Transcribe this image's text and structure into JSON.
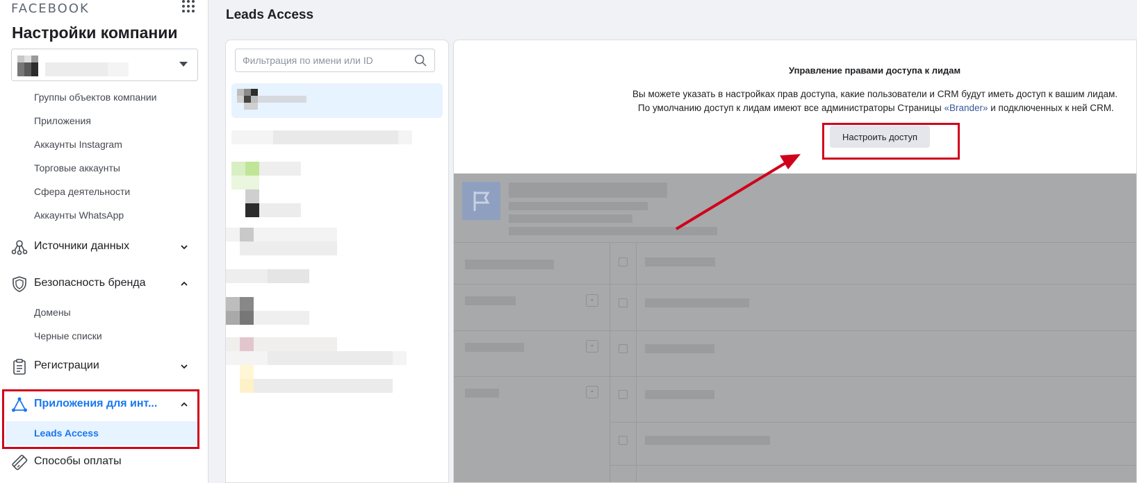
{
  "sidebar": {
    "brand": "FACEBOOK",
    "title": "Настройки компании",
    "sub_items_top": [
      "Группы объектов компании",
      "Приложения",
      "Аккаунты Instagram",
      "Торговые аккаунты",
      "Сфера деятельности",
      "Аккаунты WhatsApp"
    ],
    "sections": {
      "data_sources": "Источники данных",
      "brand_safety": "Безопасность бренда",
      "registrations": "Регистрации",
      "integrations": "Приложения для инт...",
      "payment_methods": "Способы оплаты"
    },
    "brand_safety_items": [
      "Домены",
      "Черные списки"
    ],
    "integrations_items": [
      "Leads Access"
    ]
  },
  "main": {
    "page_title": "Leads Access",
    "filter_placeholder": "Фильтрация по имени или ID",
    "detail": {
      "heading": "Управление правами доступа к лидам",
      "line1": "Вы можете указать в настройках прав доступа, какие пользователи и CRM будут иметь доступ к вашим лидам.",
      "line2_prefix": "По умолчанию доступ к лидам имеют все администраторы Страницы ",
      "line2_link": "«Brander»",
      "line2_suffix": " и подключенных к ней CRM.",
      "button": "Настроить доступ"
    },
    "overlay_minus": "-"
  },
  "colors": {
    "accent": "#1877f2",
    "highlight": "#d0021b"
  }
}
